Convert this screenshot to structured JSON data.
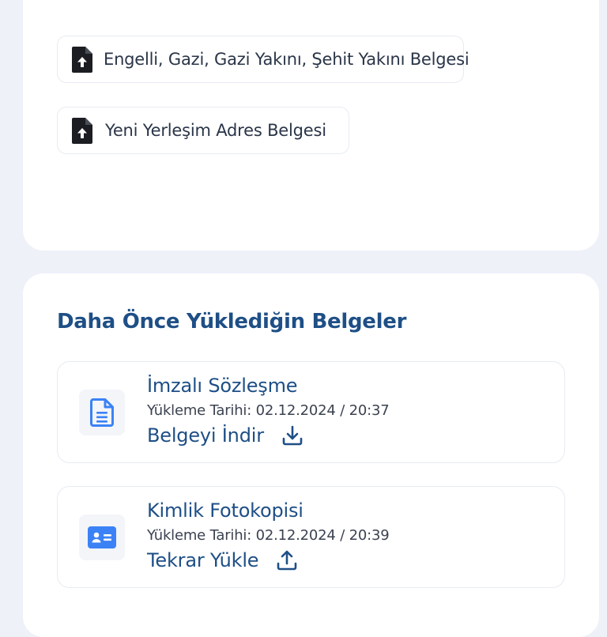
{
  "upload_options": [
    {
      "label": "Engelli, Gazi, Gazi Yakını, Şehit Yakını Belgesi",
      "icon": "file-upload-icon"
    },
    {
      "label": "Yeni Yerleşim Adres Belgesi",
      "icon": "file-upload-icon"
    }
  ],
  "uploaded_section": {
    "title": "Daha Önce Yüklediğin Belgeler",
    "documents": [
      {
        "name": "İmzalı Sözleşme",
        "date": "Yükleme Tarihi: 02.12.2024 / 20:37",
        "action": "Belgeyi İndir",
        "icon": "document-icon",
        "action_icon": "download-icon"
      },
      {
        "name": "Kimlik Fotokopisi",
        "date": "Yükleme Tarihi: 02.12.2024 / 20:39",
        "action": "Tekrar Yükle",
        "icon": "id-card-icon",
        "action_icon": "upload-icon"
      }
    ]
  },
  "colors": {
    "background": "#eef1f8",
    "primary_text": "#1e4f86",
    "icon_blue": "#3b82f6",
    "selected_green": "#3aa765"
  }
}
